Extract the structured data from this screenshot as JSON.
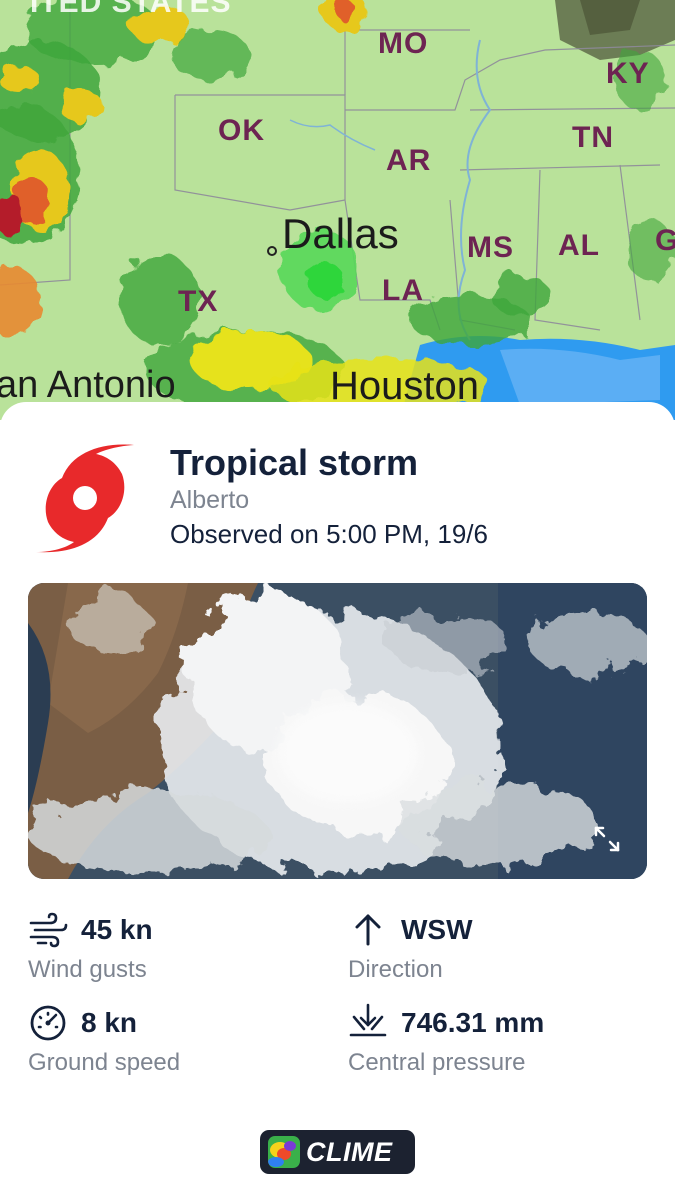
{
  "map": {
    "state_labels": [
      "MO",
      "KY",
      "OK",
      "TN",
      "AR",
      "MS",
      "AL",
      "TX",
      "LA",
      "G"
    ],
    "city_labels": [
      "Dallas",
      "an Antonio",
      "Houston"
    ],
    "partial_top_label": "ITED STATES"
  },
  "storm": {
    "icon": "hurricane-icon",
    "title": "Tropical storm",
    "name": "Alberto",
    "observed": "Observed on 5:00 PM, 19/6",
    "icon_color": "#e8292b"
  },
  "satellite": {
    "expand_icon": "expand-icon"
  },
  "stats": {
    "wind_gusts": {
      "value": "45 kn",
      "label": "Wind gusts",
      "icon": "wind-icon"
    },
    "direction": {
      "value": "WSW",
      "label": "Direction",
      "icon": "arrow-up-icon"
    },
    "ground_speed": {
      "value": "8 kn",
      "label": "Ground speed",
      "icon": "speedometer-icon"
    },
    "central_pressure": {
      "value": "746.31 mm",
      "label": "Central pressure",
      "icon": "pressure-icon"
    }
  },
  "brand": {
    "logo_text": "CLIME"
  },
  "colors": {
    "text_dark": "#14213a",
    "text_muted": "#7d8490",
    "map_land": "#b9e29a",
    "map_labels": "#6d2452"
  }
}
